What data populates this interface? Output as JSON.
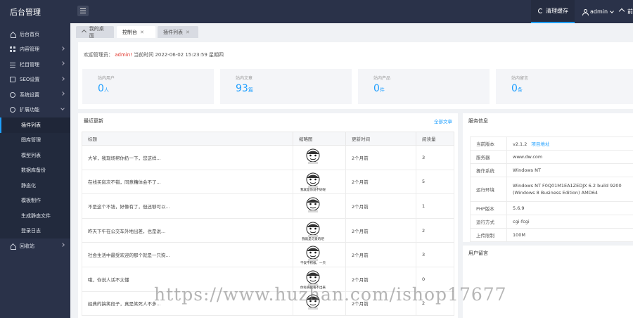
{
  "app": {
    "title": "后台管理"
  },
  "topbar": {
    "clear_cache": "清理缓存",
    "user": "admin",
    "home_label": "前"
  },
  "sidebar": {
    "items": [
      {
        "label": "后台首页"
      },
      {
        "label": "内容管理"
      },
      {
        "label": "栏目管理"
      },
      {
        "label": "SEO设置"
      },
      {
        "label": "系统设置"
      },
      {
        "label": "扩展功能"
      }
    ],
    "submenu": [
      {
        "label": "插件列表"
      },
      {
        "label": "图库管理"
      },
      {
        "label": "模型列表"
      },
      {
        "label": "数据库备份"
      },
      {
        "label": "静态化"
      },
      {
        "label": "模板制作"
      },
      {
        "label": "生成静态文件"
      },
      {
        "label": "登录日志"
      }
    ],
    "bottom_item": {
      "label": "回收站"
    }
  },
  "tabs": [
    {
      "label": "我的桌面"
    },
    {
      "label": "控制台"
    },
    {
      "label": "插件列表"
    }
  ],
  "welcome": {
    "prefix": "欢迎管理员：",
    "user": "admin!",
    "time": "当前时间 2022-06-02 15:23:59 星期四"
  },
  "stats": [
    {
      "label": "站内用户",
      "value": "0",
      "unit": "人"
    },
    {
      "label": "站内文章",
      "value": "93",
      "unit": "篇"
    },
    {
      "label": "站内产品",
      "value": "0",
      "unit": "件"
    },
    {
      "label": "站内留言",
      "value": "0",
      "unit": "条"
    }
  ],
  "latest": {
    "title": "最近更新",
    "more": "全部文章",
    "columns": [
      "标题",
      "缩略图",
      "更新时间",
      "阅读量"
    ],
    "rows": [
      {
        "title": "大爷，我现场帮你扔一下，您这样...",
        "time": "2个月前",
        "views": "3",
        "thumb_caption": ""
      },
      {
        "title": "在线买房次不错，同意糟体会不了...",
        "time": "2个月前",
        "views": "5",
        "thumb_caption": "我就是你说不好呢"
      },
      {
        "title": "不是这个不钱，好像有了，但还够可以...",
        "time": "2个月前",
        "views": "1",
        "thumb_caption": ""
      },
      {
        "title": "昨天下午在公交车外地出差，也是说...",
        "time": "2个月前",
        "views": "2",
        "thumb_caption": "我就是可爱的吧"
      },
      {
        "title": "社会生活中最受欢迎的那个就是一只狗...",
        "time": "2个月前",
        "views": "3",
        "thumb_caption": "干饭不积极，一只"
      },
      {
        "title": "哦，你说人话不太懂",
        "time": "2个月前",
        "views": "0",
        "thumb_caption": "你有病我看不出来"
      },
      {
        "title": "经典的搞笑段子，真是笑死人不多...",
        "time": "2个月前",
        "views": "2",
        "thumb_caption": ""
      }
    ]
  },
  "sysinfo": {
    "title": "服务信息",
    "rows": [
      {
        "key": "当前版本",
        "value": "v2.1.2",
        "link": "项目地址"
      },
      {
        "key": "服务器",
        "value": "www.dw.com"
      },
      {
        "key": "操作系统",
        "value": "Windows NT"
      },
      {
        "key": "运行环境",
        "value": "Windows NT F0Q01M1EA1ZEDJX 6.2 build 9200 (Windows 8 Business Edition) AMD64"
      },
      {
        "key": "PHP版本",
        "value": "5.6.9"
      },
      {
        "key": "运行方式",
        "value": "cgi-fcgi"
      },
      {
        "key": "上传限制",
        "value": "100M"
      }
    ]
  },
  "userlog": {
    "title": "用户留言"
  },
  "watermark": "https://www.huzhan.com/ishop17677"
}
